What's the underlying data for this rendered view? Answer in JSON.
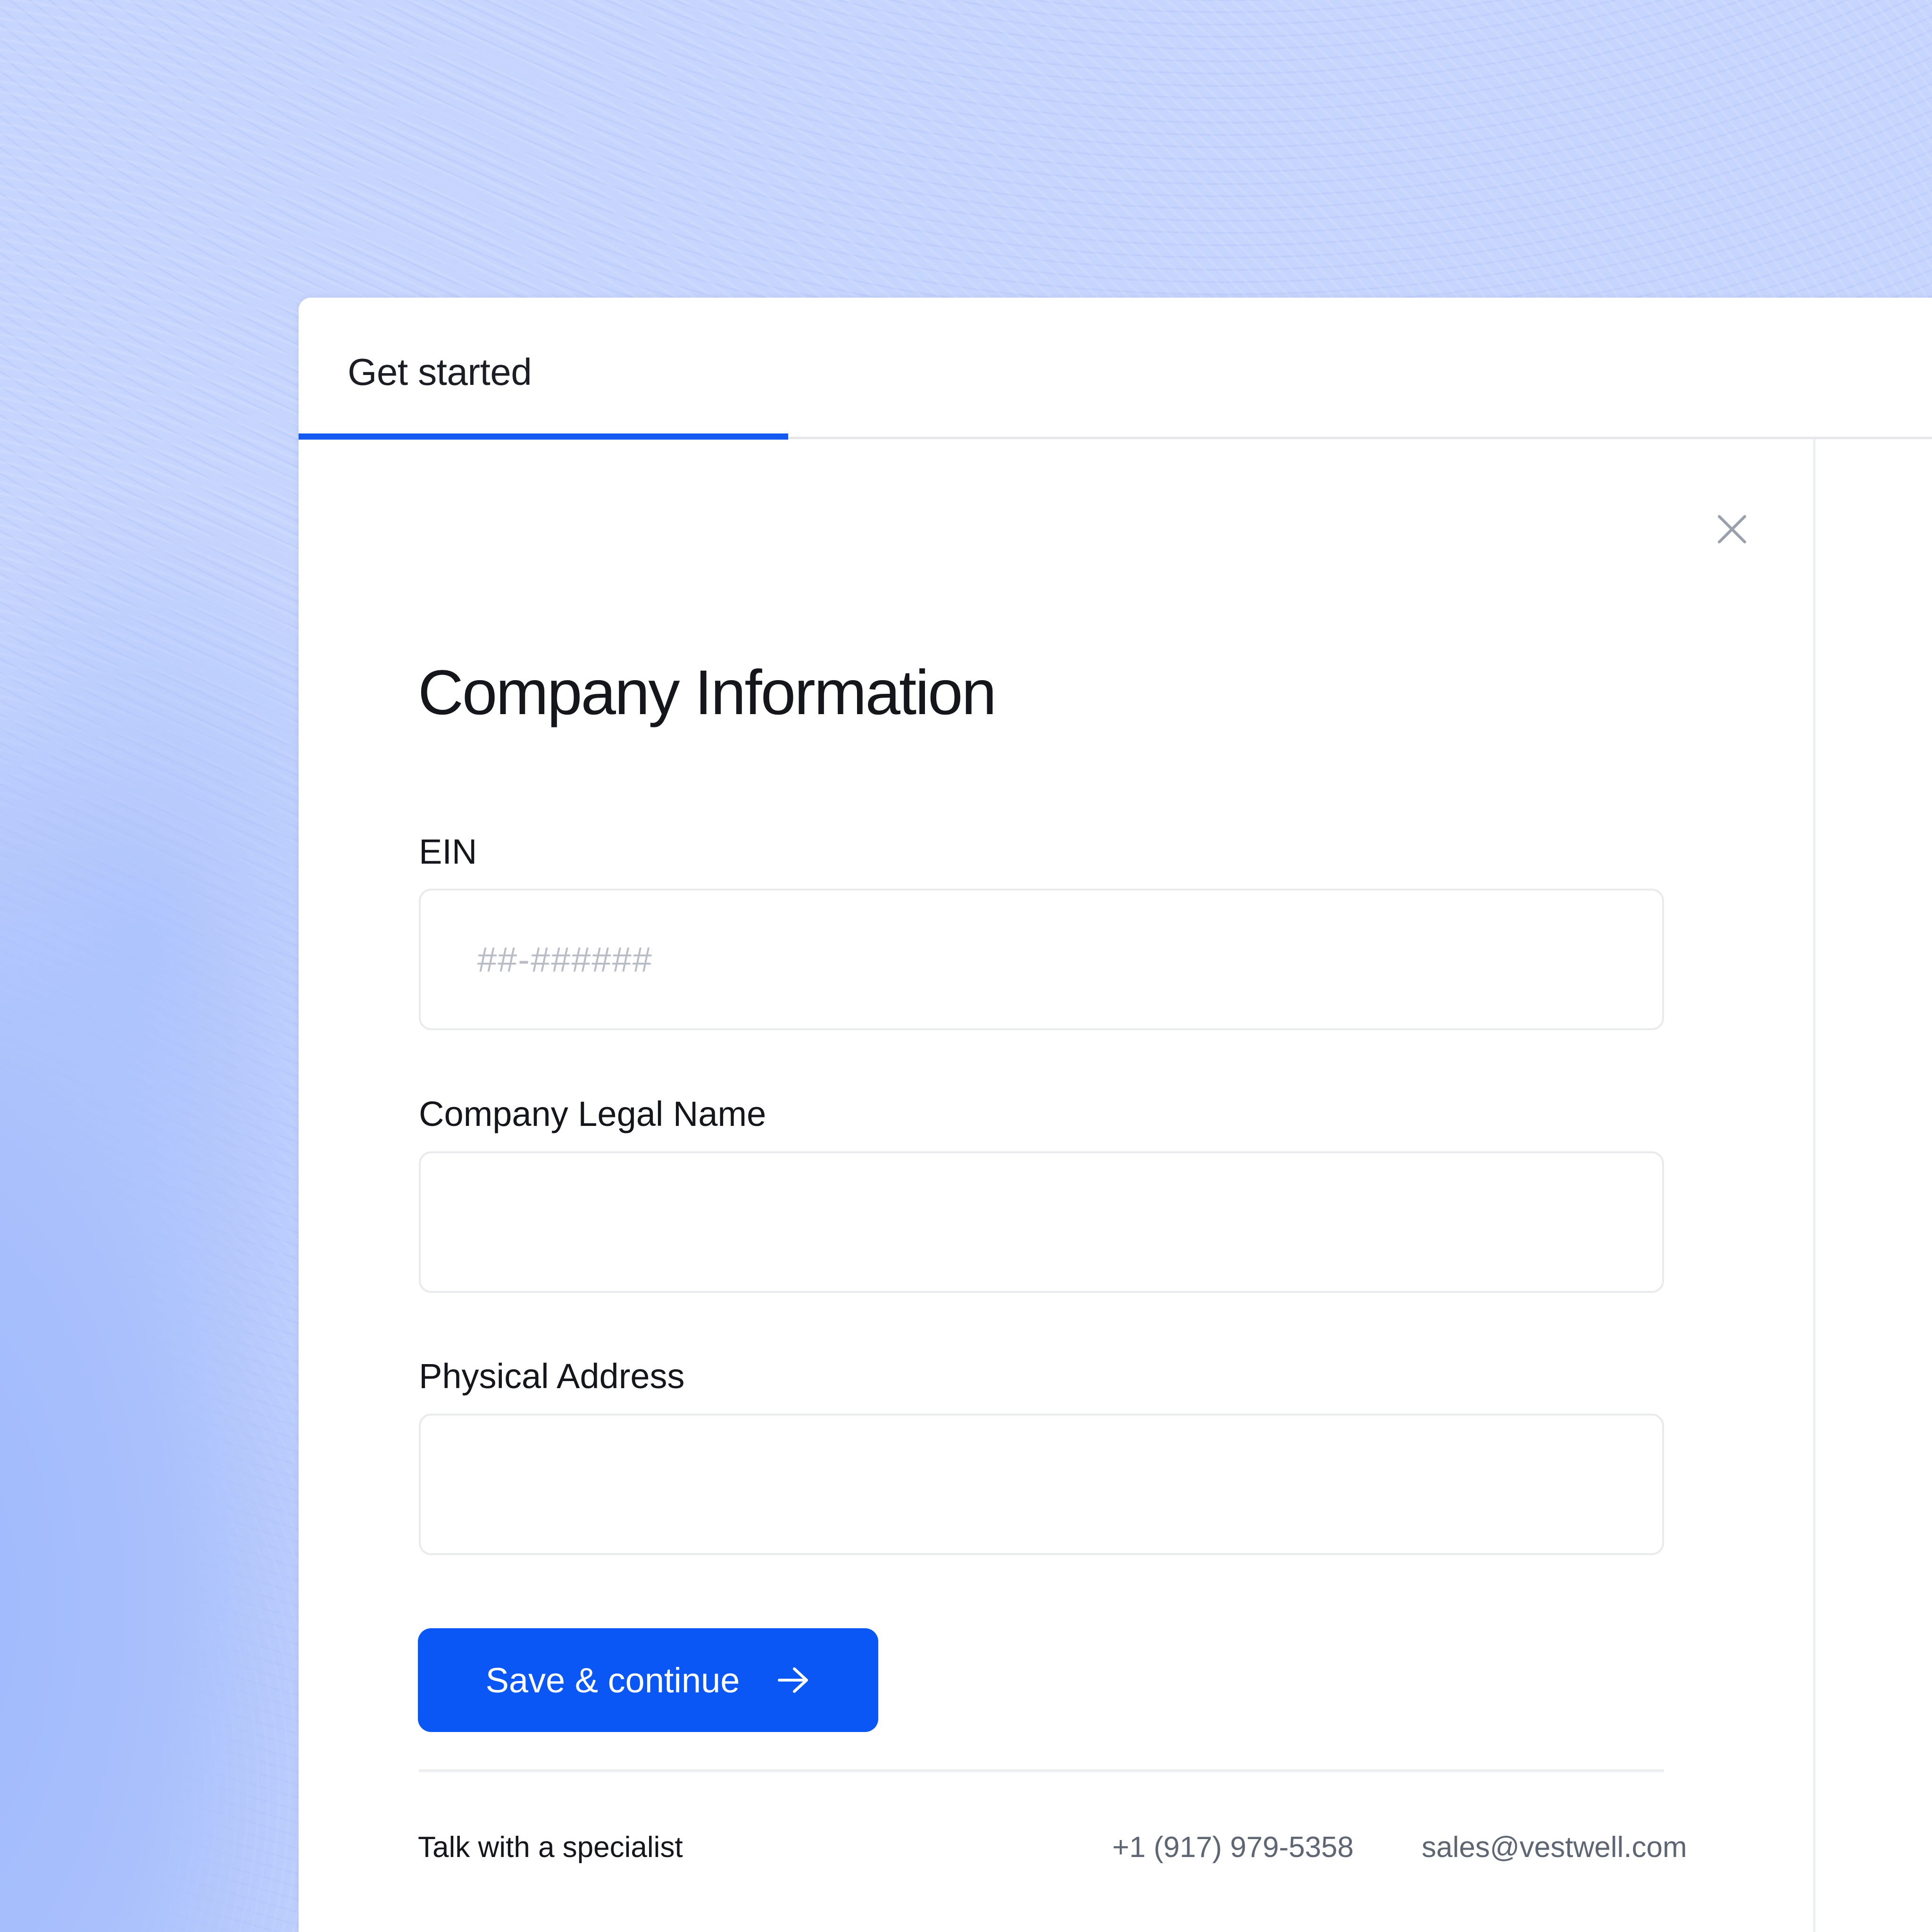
{
  "header": {
    "title": "Get started",
    "progress_fraction": 0.2998
  },
  "form": {
    "title": "Company Information",
    "fields": [
      {
        "label": "EIN",
        "placeholder": "##-######",
        "value": ""
      },
      {
        "label": "Company Legal Name",
        "placeholder": "",
        "value": ""
      },
      {
        "label": "Physical Address",
        "placeholder": "",
        "value": ""
      }
    ],
    "submit_label": "Save & continue"
  },
  "footer": {
    "title": "Talk with a specialist",
    "phone": "+1 (917) 979-5358",
    "email": "sales@vestwell.com"
  },
  "icons": {
    "close": "close-icon",
    "submit_arrow": "arrow-right-icon"
  },
  "colors": {
    "background": "#c6d5fd",
    "accent": "#0b57f5",
    "progress": "#1459f0",
    "text": "#14161c",
    "muted_text": "#5f6673"
  }
}
